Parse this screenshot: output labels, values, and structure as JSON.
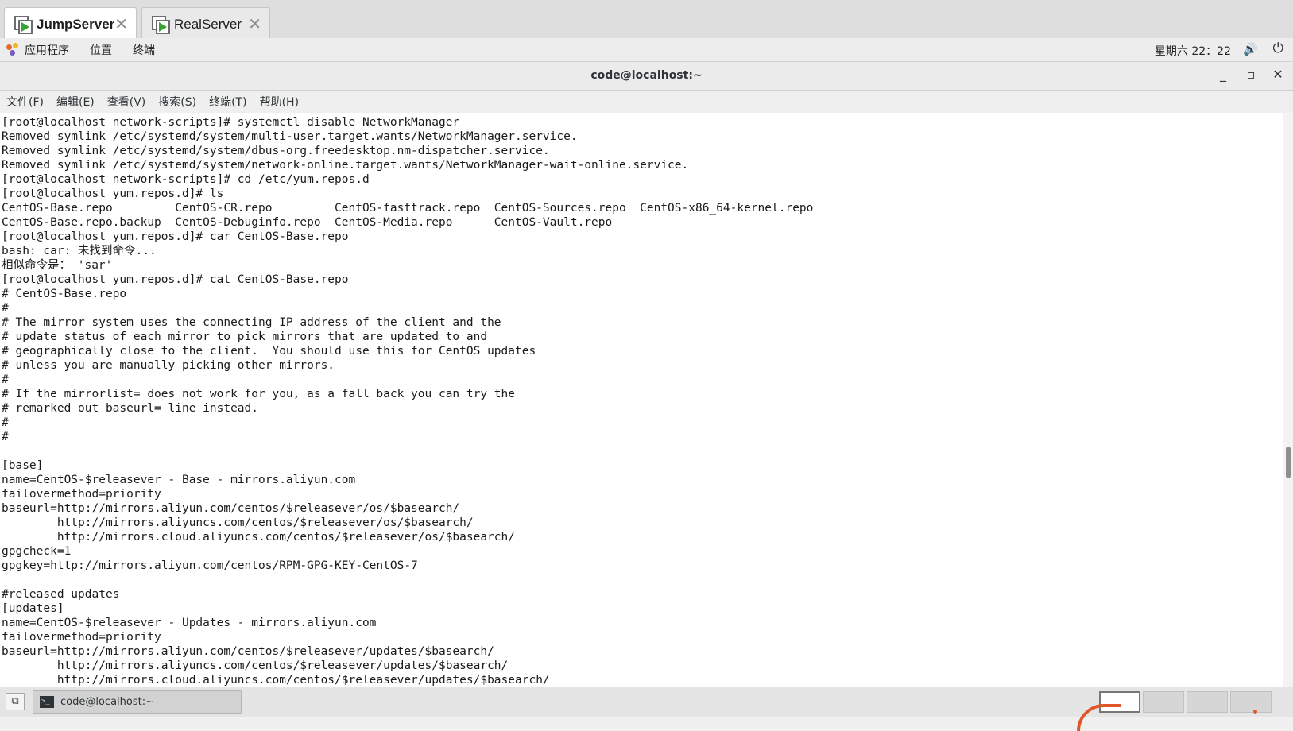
{
  "session_tabs": [
    {
      "label": "JumpServer",
      "active": true
    },
    {
      "label": "RealServer",
      "active": false
    }
  ],
  "tab_close_glyph": "✕",
  "gnome_panel": {
    "menus": [
      "应用程序",
      "位置",
      "终端"
    ],
    "clock": "星期六 22：22",
    "icons": [
      "applications-icon",
      "volume-icon",
      "power-icon"
    ]
  },
  "window": {
    "title": "code@localhost:~",
    "controls": {
      "minimize": "_",
      "maximize": "▫",
      "close": "✕"
    }
  },
  "menubar": [
    "文件(F)",
    "编辑(E)",
    "查看(V)",
    "搜索(S)",
    "终端(T)",
    "帮助(H)"
  ],
  "terminal": {
    "lines": [
      "[root@localhost network-scripts]# systemctl disable NetworkManager",
      "Removed symlink /etc/systemd/system/multi-user.target.wants/NetworkManager.service.",
      "Removed symlink /etc/systemd/system/dbus-org.freedesktop.nm-dispatcher.service.",
      "Removed symlink /etc/systemd/system/network-online.target.wants/NetworkManager-wait-online.service.",
      "[root@localhost network-scripts]# cd /etc/yum.repos.d",
      "[root@localhost yum.repos.d]# ls",
      "CentOS-Base.repo         CentOS-CR.repo         CentOS-fasttrack.repo  CentOS-Sources.repo  CentOS-x86_64-kernel.repo",
      "CentOS-Base.repo.backup  CentOS-Debuginfo.repo  CentOS-Media.repo      CentOS-Vault.repo",
      "[root@localhost yum.repos.d]# car CentOS-Base.repo",
      "bash: car: 未找到命令...",
      "相似命令是： 'sar'",
      "[root@localhost yum.repos.d]# cat CentOS-Base.repo",
      "# CentOS-Base.repo",
      "#",
      "# The mirror system uses the connecting IP address of the client and the",
      "# update status of each mirror to pick mirrors that are updated to and",
      "# geographically close to the client.  You should use this for CentOS updates",
      "# unless you are manually picking other mirrors.",
      "#",
      "# If the mirrorlist= does not work for you, as a fall back you can try the",
      "# remarked out baseurl= line instead.",
      "#",
      "#",
      "",
      "[base]",
      "name=CentOS-$releasever - Base - mirrors.aliyun.com",
      "failovermethod=priority",
      "baseurl=http://mirrors.aliyun.com/centos/$releasever/os/$basearch/",
      "        http://mirrors.aliyuncs.com/centos/$releasever/os/$basearch/",
      "        http://mirrors.cloud.aliyuncs.com/centos/$releasever/os/$basearch/",
      "gpgcheck=1",
      "gpgkey=http://mirrors.aliyun.com/centos/RPM-GPG-KEY-CentOS-7",
      "",
      "#released updates",
      "[updates]",
      "name=CentOS-$releasever - Updates - mirrors.aliyun.com",
      "failovermethod=priority",
      "baseurl=http://mirrors.aliyun.com/centos/$releasever/updates/$basearch/",
      "        http://mirrors.aliyuncs.com/centos/$releasever/updates/$basearch/",
      "        http://mirrors.cloud.aliyuncs.com/centos/$releasever/updates/$basearch/"
    ]
  },
  "taskbar": {
    "task_label": "code@localhost:~",
    "workspaces": 4,
    "active_workspace": 1
  }
}
